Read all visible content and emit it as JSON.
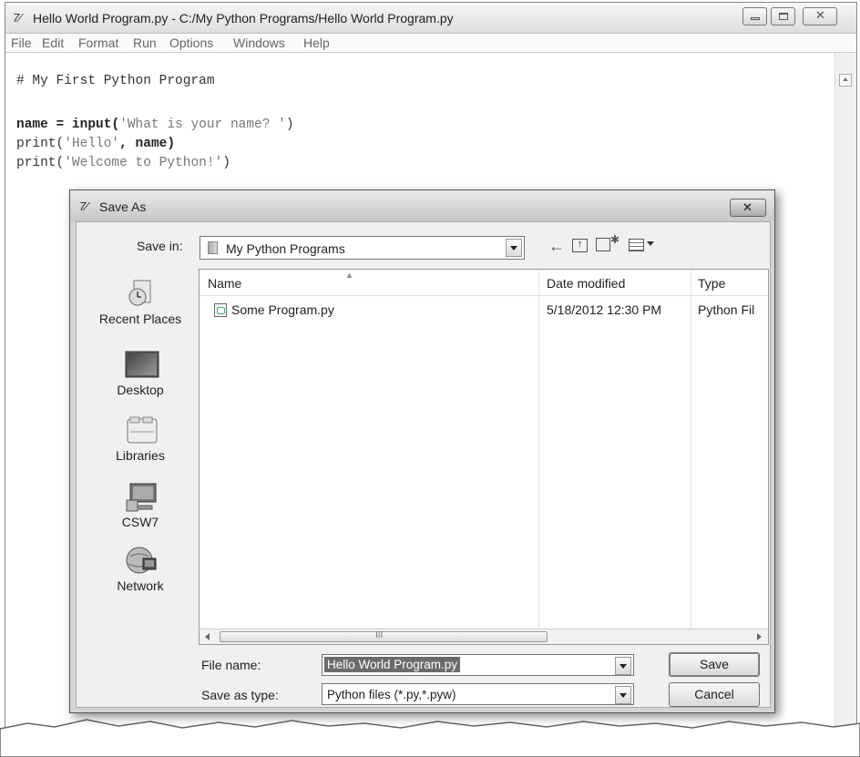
{
  "idle": {
    "title": "Hello World Program.py - C:/My Python Programs/Hello World Program.py",
    "icon_text": "7⁄",
    "menu": [
      "File",
      "Edit",
      "Format",
      "Run",
      "Options",
      "Windows",
      "Help"
    ],
    "code": {
      "line1": "# My First Python Program",
      "line3_a": "name = input(",
      "line3_s": "'What is your name? '",
      "line3_b": ")",
      "line4_a": "print(",
      "line4_s": "'Hello'",
      "line4_b": ", name)",
      "line5_a": "print(",
      "line5_s": "'Welcome to Python!'",
      "line5_b": ")"
    }
  },
  "dialog": {
    "title": "Save As",
    "save_in_label": "Save in:",
    "save_in_value": "My Python Programs",
    "places": [
      "Recent Places",
      "Desktop",
      "Libraries",
      "CSW7",
      "Network"
    ],
    "columns": [
      "Name",
      "Date modified",
      "Type"
    ],
    "files": [
      {
        "name": "Some Program.py",
        "date": "5/18/2012 12:30 PM",
        "type": "Python Fil"
      }
    ],
    "scroll_grip": "III",
    "file_name_label": "File name:",
    "file_name_value": "Hello World Program.py",
    "save_type_label": "Save as type:",
    "save_type_value": "Python files (*.py,*.pyw)",
    "save_button": "Save",
    "cancel_button": "Cancel"
  }
}
